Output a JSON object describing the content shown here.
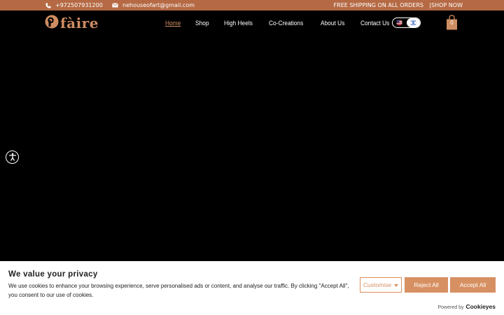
{
  "topbar": {
    "phone": "+972507931200",
    "email": "nehouseofart@gmail.com",
    "shipping": "FREE SHIPPING ON ALL ORDERS",
    "separator": "|",
    "shop_now": "SHOP NOW"
  },
  "header": {
    "logo_text": "fàire",
    "nav": [
      "Home",
      "Shop",
      "High Heels",
      "Co-Creations",
      "About Us",
      "Contact Us"
    ],
    "active_nav": "Home",
    "cart_count": "0",
    "languages": [
      "en-flag-icon",
      "il-flag-icon"
    ],
    "selected_language_index": 1
  },
  "cookie_banner": {
    "title": "We value your privacy",
    "text": "We use cookies to enhance your browsing experience, serve personalised ads or content, and analyse our traffic. By clicking \"Accept All\", you consent to our use of cookies.",
    "customise_label": "Customise",
    "reject_label": "Reject All",
    "accept_label": "Accept All",
    "powered_by": "Powered by",
    "powered_brand": "Cookieyes"
  },
  "colors": {
    "accent": "#b56a45",
    "button": "#d79062",
    "logo": "#cf8d62",
    "background": "#000000"
  }
}
